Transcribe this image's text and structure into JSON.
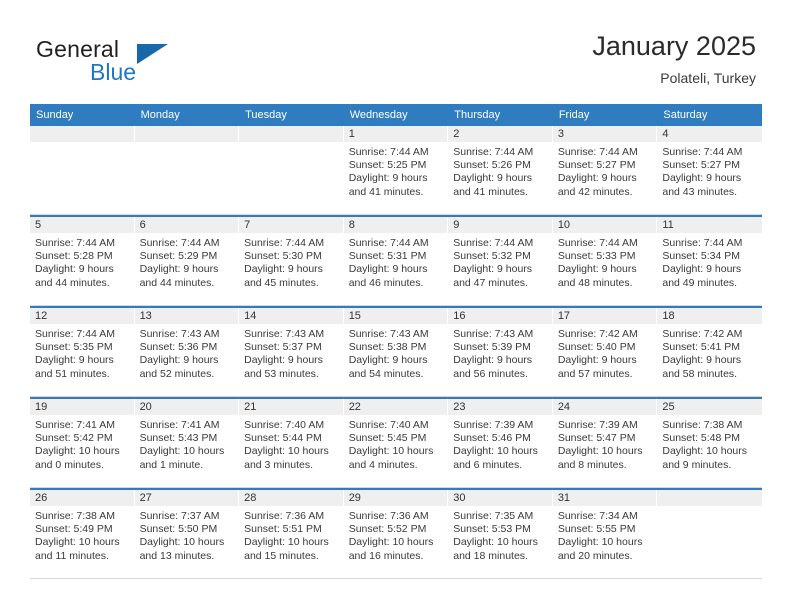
{
  "brand": {
    "name_part1": "General",
    "name_part2": "Blue",
    "flag_icon": "triangle-flag-icon"
  },
  "header": {
    "title": "January 2025",
    "subtitle": "Polateli, Turkey"
  },
  "colors": {
    "header_blue": "#2f7dc0",
    "brand_blue": "#1f78c1",
    "flag_blue": "#1769aa",
    "band_gray": "#efefef",
    "text": "#333333"
  },
  "calendar": {
    "day_headers": [
      "Sunday",
      "Monday",
      "Tuesday",
      "Wednesday",
      "Thursday",
      "Friday",
      "Saturday"
    ],
    "weeks": [
      [
        {
          "day": "",
          "empty": true,
          "lines": []
        },
        {
          "day": "",
          "empty": true,
          "lines": []
        },
        {
          "day": "",
          "empty": true,
          "lines": []
        },
        {
          "day": "1",
          "empty": false,
          "lines": [
            "Sunrise: 7:44 AM",
            "Sunset: 5:25 PM",
            "Daylight: 9 hours",
            "and 41 minutes."
          ]
        },
        {
          "day": "2",
          "empty": false,
          "lines": [
            "Sunrise: 7:44 AM",
            "Sunset: 5:26 PM",
            "Daylight: 9 hours",
            "and 41 minutes."
          ]
        },
        {
          "day": "3",
          "empty": false,
          "lines": [
            "Sunrise: 7:44 AM",
            "Sunset: 5:27 PM",
            "Daylight: 9 hours",
            "and 42 minutes."
          ]
        },
        {
          "day": "4",
          "empty": false,
          "lines": [
            "Sunrise: 7:44 AM",
            "Sunset: 5:27 PM",
            "Daylight: 9 hours",
            "and 43 minutes."
          ]
        }
      ],
      [
        {
          "day": "5",
          "empty": false,
          "lines": [
            "Sunrise: 7:44 AM",
            "Sunset: 5:28 PM",
            "Daylight: 9 hours",
            "and 44 minutes."
          ]
        },
        {
          "day": "6",
          "empty": false,
          "lines": [
            "Sunrise: 7:44 AM",
            "Sunset: 5:29 PM",
            "Daylight: 9 hours",
            "and 44 minutes."
          ]
        },
        {
          "day": "7",
          "empty": false,
          "lines": [
            "Sunrise: 7:44 AM",
            "Sunset: 5:30 PM",
            "Daylight: 9 hours",
            "and 45 minutes."
          ]
        },
        {
          "day": "8",
          "empty": false,
          "lines": [
            "Sunrise: 7:44 AM",
            "Sunset: 5:31 PM",
            "Daylight: 9 hours",
            "and 46 minutes."
          ]
        },
        {
          "day": "9",
          "empty": false,
          "lines": [
            "Sunrise: 7:44 AM",
            "Sunset: 5:32 PM",
            "Daylight: 9 hours",
            "and 47 minutes."
          ]
        },
        {
          "day": "10",
          "empty": false,
          "lines": [
            "Sunrise: 7:44 AM",
            "Sunset: 5:33 PM",
            "Daylight: 9 hours",
            "and 48 minutes."
          ]
        },
        {
          "day": "11",
          "empty": false,
          "lines": [
            "Sunrise: 7:44 AM",
            "Sunset: 5:34 PM",
            "Daylight: 9 hours",
            "and 49 minutes."
          ]
        }
      ],
      [
        {
          "day": "12",
          "empty": false,
          "lines": [
            "Sunrise: 7:44 AM",
            "Sunset: 5:35 PM",
            "Daylight: 9 hours",
            "and 51 minutes."
          ]
        },
        {
          "day": "13",
          "empty": false,
          "lines": [
            "Sunrise: 7:43 AM",
            "Sunset: 5:36 PM",
            "Daylight: 9 hours",
            "and 52 minutes."
          ]
        },
        {
          "day": "14",
          "empty": false,
          "lines": [
            "Sunrise: 7:43 AM",
            "Sunset: 5:37 PM",
            "Daylight: 9 hours",
            "and 53 minutes."
          ]
        },
        {
          "day": "15",
          "empty": false,
          "lines": [
            "Sunrise: 7:43 AM",
            "Sunset: 5:38 PM",
            "Daylight: 9 hours",
            "and 54 minutes."
          ]
        },
        {
          "day": "16",
          "empty": false,
          "lines": [
            "Sunrise: 7:43 AM",
            "Sunset: 5:39 PM",
            "Daylight: 9 hours",
            "and 56 minutes."
          ]
        },
        {
          "day": "17",
          "empty": false,
          "lines": [
            "Sunrise: 7:42 AM",
            "Sunset: 5:40 PM",
            "Daylight: 9 hours",
            "and 57 minutes."
          ]
        },
        {
          "day": "18",
          "empty": false,
          "lines": [
            "Sunrise: 7:42 AM",
            "Sunset: 5:41 PM",
            "Daylight: 9 hours",
            "and 58 minutes."
          ]
        }
      ],
      [
        {
          "day": "19",
          "empty": false,
          "lines": [
            "Sunrise: 7:41 AM",
            "Sunset: 5:42 PM",
            "Daylight: 10 hours",
            "and 0 minutes."
          ]
        },
        {
          "day": "20",
          "empty": false,
          "lines": [
            "Sunrise: 7:41 AM",
            "Sunset: 5:43 PM",
            "Daylight: 10 hours",
            "and 1 minute."
          ]
        },
        {
          "day": "21",
          "empty": false,
          "lines": [
            "Sunrise: 7:40 AM",
            "Sunset: 5:44 PM",
            "Daylight: 10 hours",
            "and 3 minutes."
          ]
        },
        {
          "day": "22",
          "empty": false,
          "lines": [
            "Sunrise: 7:40 AM",
            "Sunset: 5:45 PM",
            "Daylight: 10 hours",
            "and 4 minutes."
          ]
        },
        {
          "day": "23",
          "empty": false,
          "lines": [
            "Sunrise: 7:39 AM",
            "Sunset: 5:46 PM",
            "Daylight: 10 hours",
            "and 6 minutes."
          ]
        },
        {
          "day": "24",
          "empty": false,
          "lines": [
            "Sunrise: 7:39 AM",
            "Sunset: 5:47 PM",
            "Daylight: 10 hours",
            "and 8 minutes."
          ]
        },
        {
          "day": "25",
          "empty": false,
          "lines": [
            "Sunrise: 7:38 AM",
            "Sunset: 5:48 PM",
            "Daylight: 10 hours",
            "and 9 minutes."
          ]
        }
      ],
      [
        {
          "day": "26",
          "empty": false,
          "lines": [
            "Sunrise: 7:38 AM",
            "Sunset: 5:49 PM",
            "Daylight: 10 hours",
            "and 11 minutes."
          ]
        },
        {
          "day": "27",
          "empty": false,
          "lines": [
            "Sunrise: 7:37 AM",
            "Sunset: 5:50 PM",
            "Daylight: 10 hours",
            "and 13 minutes."
          ]
        },
        {
          "day": "28",
          "empty": false,
          "lines": [
            "Sunrise: 7:36 AM",
            "Sunset: 5:51 PM",
            "Daylight: 10 hours",
            "and 15 minutes."
          ]
        },
        {
          "day": "29",
          "empty": false,
          "lines": [
            "Sunrise: 7:36 AM",
            "Sunset: 5:52 PM",
            "Daylight: 10 hours",
            "and 16 minutes."
          ]
        },
        {
          "day": "30",
          "empty": false,
          "lines": [
            "Sunrise: 7:35 AM",
            "Sunset: 5:53 PM",
            "Daylight: 10 hours",
            "and 18 minutes."
          ]
        },
        {
          "day": "31",
          "empty": false,
          "lines": [
            "Sunrise: 7:34 AM",
            "Sunset: 5:55 PM",
            "Daylight: 10 hours",
            "and 20 minutes."
          ]
        },
        {
          "day": "",
          "empty": true,
          "lines": []
        }
      ]
    ]
  }
}
